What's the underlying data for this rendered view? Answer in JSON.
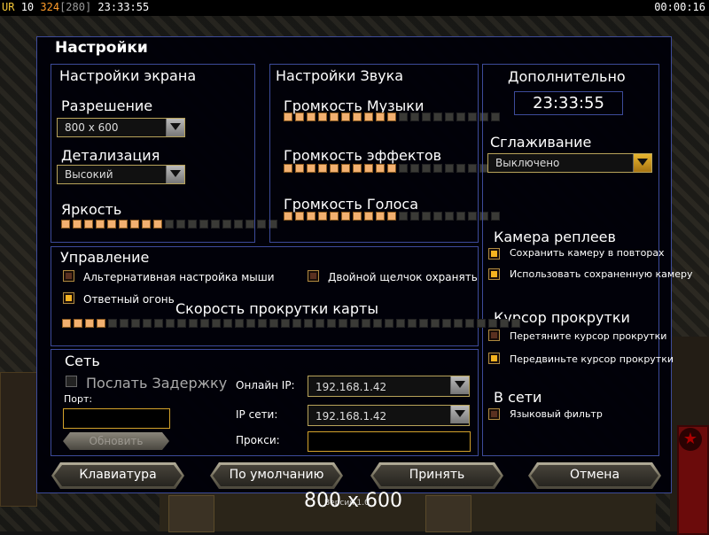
{
  "topbar": {
    "rank": "UR",
    "level": "10",
    "resource": "324",
    "resource_sub": "[280]",
    "clock": "23:33:55",
    "timer": "00:00:16"
  },
  "dialog": {
    "title": "Настройки",
    "screen": {
      "heading": "Настройки экрана",
      "resolution_label": "Разрешение",
      "resolution_value": "800 x 600",
      "detail_label": "Детализация",
      "detail_value": "Высокий",
      "brightness_label": "Яркость",
      "brightness_level": 9,
      "brightness_steps": 19
    },
    "sound": {
      "heading": "Настройки Звука",
      "music_label": "Громкость Музыки",
      "music_level": 10,
      "effects_label": "Громкость эффектов",
      "effects_level": 10,
      "voice_label": "Громкость Голоса",
      "voice_level": 10,
      "steps": 19
    },
    "advanced": {
      "heading": "Дополнительно",
      "clock": "23:33:55",
      "antialias_label": "Сглаживание",
      "antialias_value": "Выключено",
      "replay_camera_heading": "Камера реплеев",
      "save_camera_label": "Сохранить камеру в повторах",
      "save_camera_checked": true,
      "use_saved_camera_label": "Использовать сохраненную камеру",
      "use_saved_camera_checked": true,
      "scroll_cursor_heading": "Курсор прокрутки",
      "drag_cursor_label": "Перетяните курсор прокрутки",
      "drag_cursor_checked": false,
      "move_cursor_label": "Передвиньте курсор прокрутки",
      "move_cursor_checked": true,
      "online_heading": "В сети",
      "language_filter_label": "Языковый фильтр",
      "language_filter_checked": false
    },
    "control": {
      "heading": "Управление",
      "alt_mouse_label": "Альтернативная настройка мыши",
      "alt_mouse_checked": false,
      "double_click_label": "Двойной щелчок охранять",
      "double_click_checked": false,
      "return_fire_label": "Ответный огонь",
      "return_fire_checked": true,
      "scroll_speed_label": "Скорость прокрутки карты",
      "scroll_speed_level": 4,
      "scroll_speed_steps": 40
    },
    "network": {
      "heading": "Сеть",
      "send_latency_label": "Послать Задержку",
      "port_label": "Порт:",
      "port_value": "",
      "refresh_label": "Обновить",
      "online_ip_label": "Онлайн IP:",
      "online_ip_value": "192.168.1.42",
      "lan_ip_label": "IP сети:",
      "lan_ip_value": "192.168.1.42",
      "proxy_label": "Прокси:",
      "proxy_value": ""
    },
    "buttons": {
      "keyboard": "Клавиатура",
      "defaults": "По умолчанию",
      "accept": "Принять",
      "cancel": "Отмена"
    },
    "resolution_overlay": "800 x 600",
    "version_text": "Версия 1.0"
  },
  "colors": {
    "panel_border": "#3d4b9a",
    "accent_gold": "#d4a22a",
    "slider_on": "#f2b070"
  }
}
